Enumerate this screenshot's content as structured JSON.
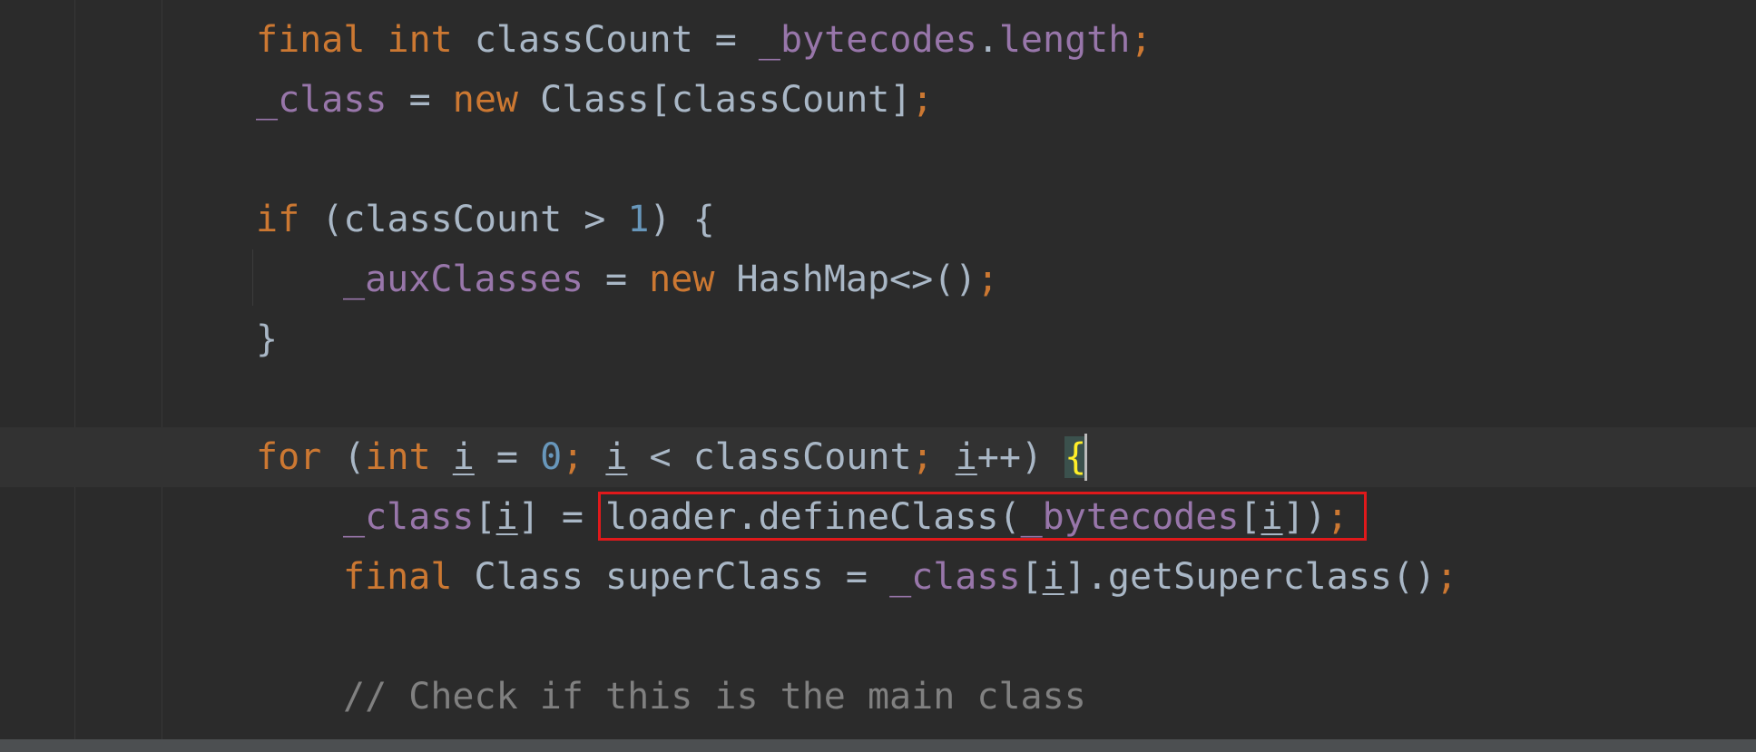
{
  "editor": {
    "lines": [
      [
        {
          "t": "final ",
          "c": "kw"
        },
        {
          "t": "int ",
          "c": "kw"
        },
        {
          "t": "classCount = ",
          "c": "plain"
        },
        {
          "t": "_bytecodes",
          "c": "fld"
        },
        {
          "t": ".",
          "c": "plain"
        },
        {
          "t": "length",
          "c": "fld"
        },
        {
          "t": ";",
          "c": "semi"
        }
      ],
      [
        {
          "t": "_class",
          "c": "fld"
        },
        {
          "t": " = ",
          "c": "plain"
        },
        {
          "t": "new ",
          "c": "kw"
        },
        {
          "t": "Class[classCount]",
          "c": "plain"
        },
        {
          "t": ";",
          "c": "semi"
        }
      ],
      [],
      [
        {
          "t": "if ",
          "c": "kw"
        },
        {
          "t": "(classCount > ",
          "c": "plain"
        },
        {
          "t": "1",
          "c": "num"
        },
        {
          "t": ") {",
          "c": "plain"
        }
      ],
      [
        {
          "t": "_auxClasses",
          "c": "fld"
        },
        {
          "t": " = ",
          "c": "plain"
        },
        {
          "t": "new ",
          "c": "kw"
        },
        {
          "t": "HashMap<>()",
          "c": "plain"
        },
        {
          "t": ";",
          "c": "semi"
        }
      ],
      [
        {
          "t": "}",
          "c": "plain"
        }
      ],
      [],
      [
        {
          "t": "for ",
          "c": "kw"
        },
        {
          "t": "(",
          "c": "plain"
        },
        {
          "t": "int ",
          "c": "kw"
        },
        {
          "t": "i",
          "c": "plain var-u"
        },
        {
          "t": " = ",
          "c": "plain"
        },
        {
          "t": "0",
          "c": "num"
        },
        {
          "t": "; ",
          "c": "semi"
        },
        {
          "t": "i",
          "c": "plain var-u"
        },
        {
          "t": " < classCount",
          "c": "plain"
        },
        {
          "t": "; ",
          "c": "semi"
        },
        {
          "t": "i",
          "c": "plain var-u"
        },
        {
          "t": "++) ",
          "c": "plain"
        },
        {
          "t": "{",
          "c": "brace-hl"
        }
      ],
      [
        {
          "t": "_class",
          "c": "fld"
        },
        {
          "t": "[",
          "c": "plain"
        },
        {
          "t": "i",
          "c": "plain var-u"
        },
        {
          "t": "] = loader.defineClass(",
          "c": "plain"
        },
        {
          "t": "_bytecodes",
          "c": "fld"
        },
        {
          "t": "[",
          "c": "plain"
        },
        {
          "t": "i",
          "c": "plain var-u"
        },
        {
          "t": "])",
          "c": "plain"
        },
        {
          "t": ";",
          "c": "semi"
        }
      ],
      [
        {
          "t": "final ",
          "c": "kw"
        },
        {
          "t": "Class superClass = ",
          "c": "plain"
        },
        {
          "t": "_class",
          "c": "fld"
        },
        {
          "t": "[",
          "c": "plain"
        },
        {
          "t": "i",
          "c": "plain var-u"
        },
        {
          "t": "].getSuperclass()",
          "c": "plain"
        },
        {
          "t": ";",
          "c": "semi"
        }
      ],
      [],
      [
        {
          "t": "// Check if this is the main class",
          "c": "cmt"
        }
      ]
    ]
  },
  "colors": {
    "background": "#2b2b2b",
    "keyword": "#cc7832",
    "field": "#9876aa",
    "number": "#6897bb",
    "comment": "#808080",
    "text": "#a9b7c6",
    "brace_match": "#ffef28",
    "highlight_box": "#e0191b"
  }
}
